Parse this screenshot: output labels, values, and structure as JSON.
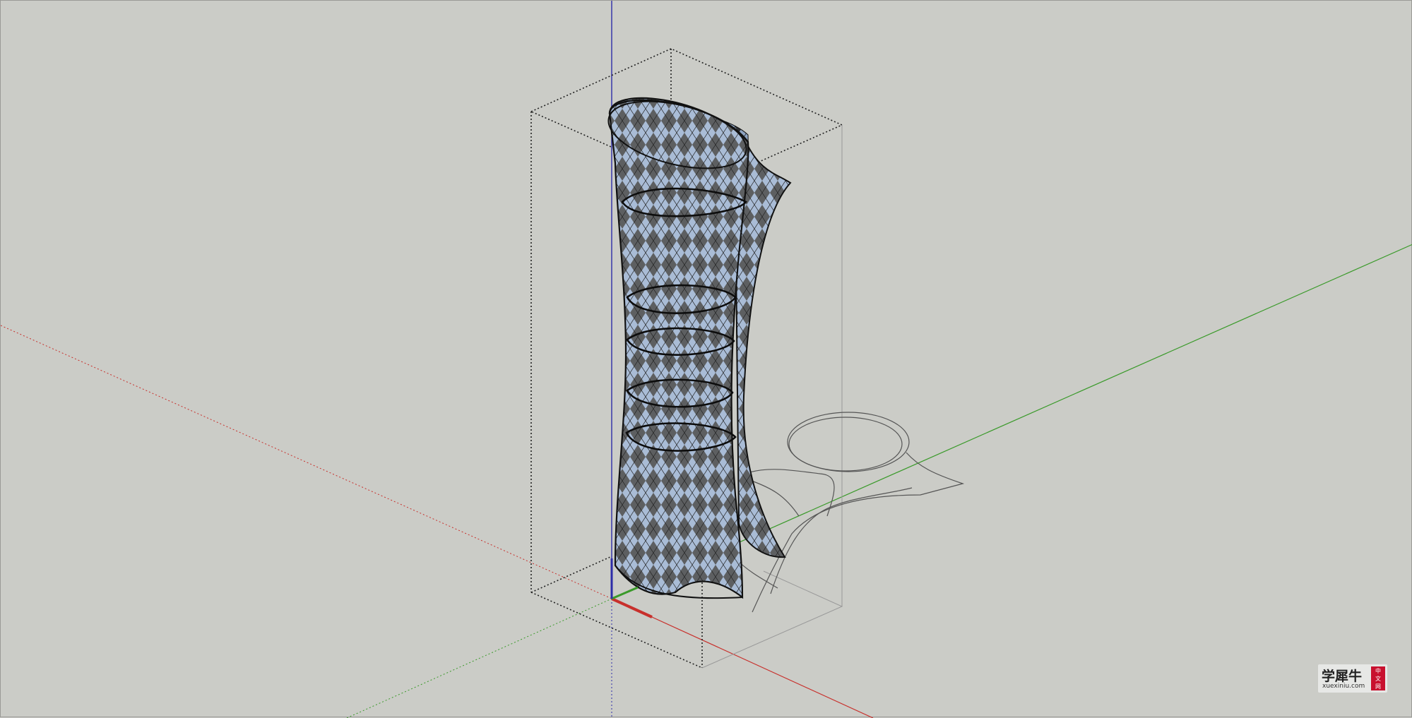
{
  "colors": {
    "background": "#cbccc7",
    "axis_red": "#c8302c",
    "axis_green": "#3a9a2a",
    "axis_blue": "#2c2ca8",
    "panel_light": "#a9bcd6",
    "panel_dark": "#5c5e60",
    "edge": "#1b1b1b",
    "watermark_badge": "#c8102e"
  },
  "viewport": {
    "icons": {
      "model": "parametric-tower-model",
      "axes": "xyz-axes-icon"
    }
  },
  "watermark": {
    "main": "学犀牛",
    "sub": "xuexiniu.com",
    "badge": [
      "中",
      "文",
      "网"
    ]
  }
}
